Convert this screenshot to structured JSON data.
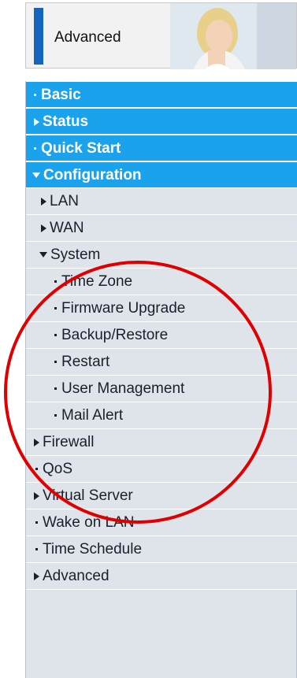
{
  "header": {
    "title": "Advanced"
  },
  "menu": {
    "top": [
      {
        "label": "Basic",
        "marker": "dot"
      },
      {
        "label": "Status",
        "marker": "arrow-right"
      },
      {
        "label": "Quick Start",
        "marker": "dot"
      },
      {
        "label": "Configuration",
        "marker": "arrow-down"
      }
    ],
    "configuration": [
      {
        "label": "LAN",
        "marker": "arrow-right"
      },
      {
        "label": "WAN",
        "marker": "arrow-right"
      },
      {
        "label": "System",
        "marker": "arrow-down"
      }
    ],
    "system": [
      {
        "label": "Time Zone"
      },
      {
        "label": "Firmware Upgrade"
      },
      {
        "label": "Backup/Restore"
      },
      {
        "label": "Restart"
      },
      {
        "label": "User Management"
      },
      {
        "label": "Mail Alert"
      }
    ],
    "more": [
      {
        "label": "Firewall",
        "marker": "arrow-right"
      },
      {
        "label": "QoS",
        "marker": "dot"
      },
      {
        "label": "Virtual Server",
        "marker": "arrow-right"
      },
      {
        "label": "Wake on LAN",
        "marker": "dot"
      },
      {
        "label": "Time Schedule",
        "marker": "dot"
      },
      {
        "label": "Advanced",
        "marker": "arrow-right"
      }
    ]
  },
  "colors": {
    "top_item_bg": "#1aa3ec",
    "sub_item_bg": "#dfe4ea",
    "header_accent": "#1565c0",
    "annotation": "#e00000"
  }
}
